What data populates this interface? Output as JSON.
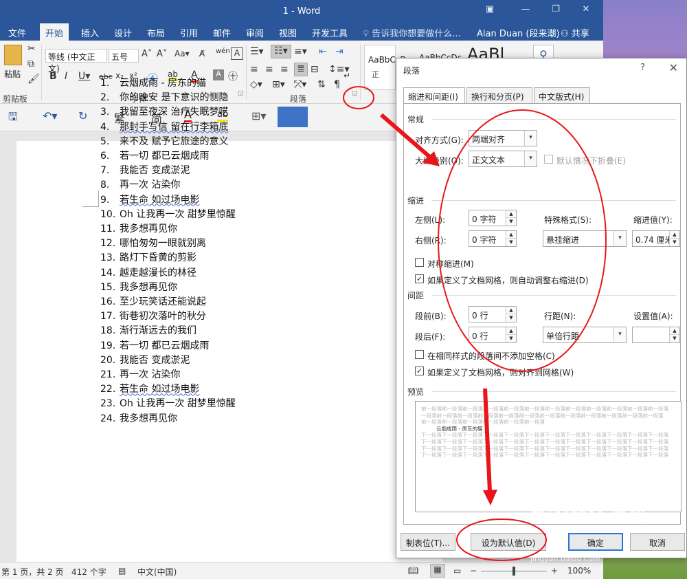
{
  "window": {
    "title": "1 - Word"
  },
  "tabs": [
    "文件",
    "开始",
    "插入",
    "设计",
    "布局",
    "引用",
    "邮件",
    "审阅",
    "视图",
    "开发工具"
  ],
  "tell_me": "告诉我你想要做什么...",
  "user": "Alan Duan (段来潮)",
  "share": "共享",
  "ribbon": {
    "paste_label": "粘贴",
    "clipboard_group": "剪贴板",
    "font_name": "等线 (中文正文)",
    "font_size": "五号",
    "font_group": "字体",
    "paragraph_group": "段落",
    "style_preview_1": "AaBbCcDc",
    "style_preview_2": "AaBbCcDc",
    "style_preview_3": "AaBl",
    "style_partial": "正"
  },
  "qat": {
    "trad": "繁",
    "simp": "简"
  },
  "document": {
    "lines": [
      {
        "n": "1.",
        "t": "云烟成雨  -  房东的猫"
      },
      {
        "n": "2.",
        "t": "你的晚安  是下意识的恻隐"
      },
      {
        "n": "3.",
        "t": "我留至夜深  治疗失眠梦呓"
      },
      {
        "n": "4.",
        "t": "那封手写信  留在行李箱底"
      },
      {
        "n": "5.",
        "t": "来不及  赋予它旅途的意义"
      },
      {
        "n": "6.",
        "t": "若一切  都已云烟成雨"
      },
      {
        "n": "7.",
        "t": "我能否  变成淤泥"
      },
      {
        "n": "8.",
        "t": "再一次  沾染你"
      },
      {
        "n": "9.",
        "t": "若生命  如过场电影"
      },
      {
        "n": "10.",
        "t": "Oh 让我再一次  甜梦里惊醒"
      },
      {
        "n": "11.",
        "t": "我多想再见你"
      },
      {
        "n": "12.",
        "t": "哪怕匆匆一眼就别离"
      },
      {
        "n": "13.",
        "t": "路灯下昏黄的剪影"
      },
      {
        "n": "14.",
        "t": "越走越漫长的林径"
      },
      {
        "n": "15.",
        "t": "我多想再见你"
      },
      {
        "n": "16.",
        "t": "至少玩笑话还能说起"
      },
      {
        "n": "17.",
        "t": "街巷初次落叶的秋分"
      },
      {
        "n": "18.",
        "t": "渐行渐远去的我们"
      },
      {
        "n": "19.",
        "t": "若一切  都已云烟成雨"
      },
      {
        "n": "20.",
        "t": "我能否  变成淤泥"
      },
      {
        "n": "21.",
        "t": "再一次  沾染你"
      },
      {
        "n": "22.",
        "t": "若生命  如过场电影"
      },
      {
        "n": "23.",
        "t": "Oh 让我再一次  甜梦里惊醒"
      },
      {
        "n": "24.",
        "t": "我多想再见你"
      }
    ]
  },
  "status": {
    "page": "第 1 页，共 2 页",
    "words": "412 个字",
    "lang": "中文(中国)",
    "zoom": "100%"
  },
  "dialog": {
    "title": "段落",
    "help": "?",
    "tabs": [
      "缩进和间距(I)",
      "换行和分页(P)",
      "中文版式(H)"
    ],
    "general": "常规",
    "align_label": "对齐方式(G):",
    "align_value": "两端对齐",
    "outline_label": "大纲级别(O):",
    "outline_value": "正文文本",
    "collapse_label": "默认情况下折叠(E)",
    "indent": "缩进",
    "left_label": "左侧(L):",
    "left_value": "0 字符",
    "right_label": "右侧(R):",
    "right_value": "0 字符",
    "special_label": "特殊格式(S):",
    "special_value": "悬挂缩进",
    "indent_by_label": "缩进值(Y):",
    "indent_by_value": "0.74 厘米",
    "mirror_label": "对称缩进(M)",
    "auto_right_label": "如果定义了文档网格，则自动调整右缩进(D)",
    "spacing": "间距",
    "before_label": "段前(B):",
    "before_value": "0 行",
    "after_label": "段后(F):",
    "after_value": "0 行",
    "line_label": "行距(N):",
    "line_value": "单倍行距",
    "at_label": "设置值(A):",
    "at_value": "",
    "no_space_label": "在相同样式的段落间不添加空格(C)",
    "snap_label": "如果定义了文档网格，则对齐到网格(W)",
    "preview": "预览",
    "preview_prev": "前一段落前一段落前一段落前一段落前一段落前一段落前一段落前一段落前一段落前一段落前一段落前一段落",
    "preview_prev2": "一段落前一段落前一段落前一段落前一段落前一段落前一段落前一段落前一段落前一段落前一段落前一段落",
    "preview_prev3": "前一段落前一段落前一段落前一段落前一段落前一段落",
    "preview_cur": "云烟成雨 - 房东的猫",
    "preview_next": "下一段落下一段落下一段落下一段落下一段落下一段落下一段落下一段落下一段落下一段落下一段落下一段落",
    "tabs_btn": "制表位(T)...",
    "default_btn": "设为默认值(D)",
    "ok_btn": "确定",
    "cancel_btn": "取消"
  },
  "watermark": {
    "main": "Baidu 经验",
    "sub": "jingyan.baidu.com"
  },
  "colors": {
    "word_blue": "#2b579a",
    "annotation_red": "#e8161b"
  }
}
